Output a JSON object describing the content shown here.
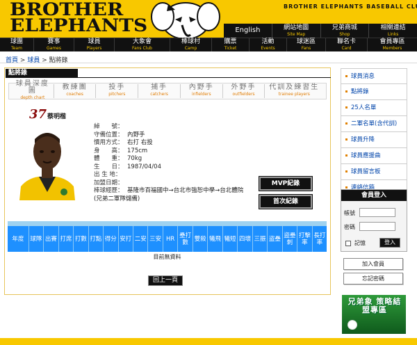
{
  "header": {
    "logo_line1": "BROTHER",
    "logo_line2": "ELEPHANTS",
    "club_name": "BROTHER ELEPHANTS BASEBALL CLUB",
    "toplinks": [
      {
        "zh": "English",
        "en": ""
      },
      {
        "zh": "網站地圖",
        "en": "Site Map"
      },
      {
        "zh": "兄弟商城",
        "en": "Shop"
      },
      {
        "zh": "相關連結",
        "en": "Links"
      }
    ]
  },
  "nav": [
    {
      "zh": "球團",
      "en": "Team"
    },
    {
      "zh": "賽事",
      "en": "Games"
    },
    {
      "zh": "球員",
      "en": "Players"
    },
    {
      "zh": "大象會",
      "en": "Fans Club"
    },
    {
      "zh": "棒球村",
      "en": "Camp"
    },
    {
      "zh": "購票",
      "en": "Ticket"
    },
    {
      "zh": "活動",
      "en": "Events"
    },
    {
      "zh": "球迷區",
      "en": "Fans"
    },
    {
      "zh": "聯名卡",
      "en": "Card"
    },
    {
      "zh": "會員專區",
      "en": "Members"
    }
  ],
  "breadcrumb": {
    "home": "首頁",
    "players": "球員",
    "current": "點將錄",
    "separator": ">"
  },
  "section_title": "點將錄",
  "tabs": [
    {
      "zh": "球員深度圖",
      "en": "depth chart"
    },
    {
      "zh": "教練團",
      "en": "coaches"
    },
    {
      "zh": "投手",
      "en": "pitchers"
    },
    {
      "zh": "捕手",
      "en": "catchers"
    },
    {
      "zh": "內野手",
      "en": "infielders"
    },
    {
      "zh": "外野手",
      "en": "outfielders"
    },
    {
      "zh": "代訓及練習生",
      "en": "trainee players"
    }
  ],
  "player": {
    "number": "37",
    "name": "蔡明楷",
    "fields": [
      {
        "label": "綽　　號：",
        "value": ""
      },
      {
        "label": "守備位置：",
        "value": "內野手"
      },
      {
        "label": "慣用方式：",
        "value": "右打 右投"
      },
      {
        "label": "身　　高：",
        "value": "175cm"
      },
      {
        "label": "體　　重：",
        "value": "70kg"
      },
      {
        "label": "生　　日：",
        "value": "1987/04/04"
      },
      {
        "label": "出 生 地：",
        "value": ""
      },
      {
        "label": "加盟日期：",
        "value": ""
      },
      {
        "label": "棒球經歷：",
        "value": "基隆市百福國中→台北市強恕中學→台北體院"
      },
      {
        "label": "",
        "value": "(兄弟二軍隊儲備)"
      }
    ]
  },
  "buttons": {
    "mvp": "MVP紀錄",
    "first": "首次紀錄",
    "back": "回上一頁"
  },
  "stats": {
    "headers": [
      "年度",
      "球隊",
      "出賽",
      "打席",
      "打數",
      "打點",
      "得分",
      "安打",
      "二安",
      "三安",
      "HR",
      "壘打數",
      "雙殺",
      "犧飛",
      "犧短",
      "四壞",
      "三振",
      "盜壘",
      "盜壘刺",
      "打擊率",
      "長打率"
    ],
    "empty_message": "目前無資料"
  },
  "sidebar": {
    "menu": [
      "球員消息",
      "點將錄",
      "25人名單",
      "二軍名單(含代訓)",
      "球員升降",
      "球員應援曲",
      "球員留言板",
      "連絡信箱"
    ],
    "login": {
      "title": "會員登入",
      "user_label": "帳號",
      "pass_label": "密碼",
      "remember": "記憶",
      "submit": "登入"
    },
    "join": "加入會員",
    "forgot": "忘記密碼",
    "banner": "兄弟象 策略結盟專區"
  },
  "colors": {
    "brand_yellow": "#f8c800",
    "nav_black": "#111111",
    "table_blue": "#1e90ff",
    "link_blue": "#0044aa",
    "number_red": "#8a0a0a"
  }
}
